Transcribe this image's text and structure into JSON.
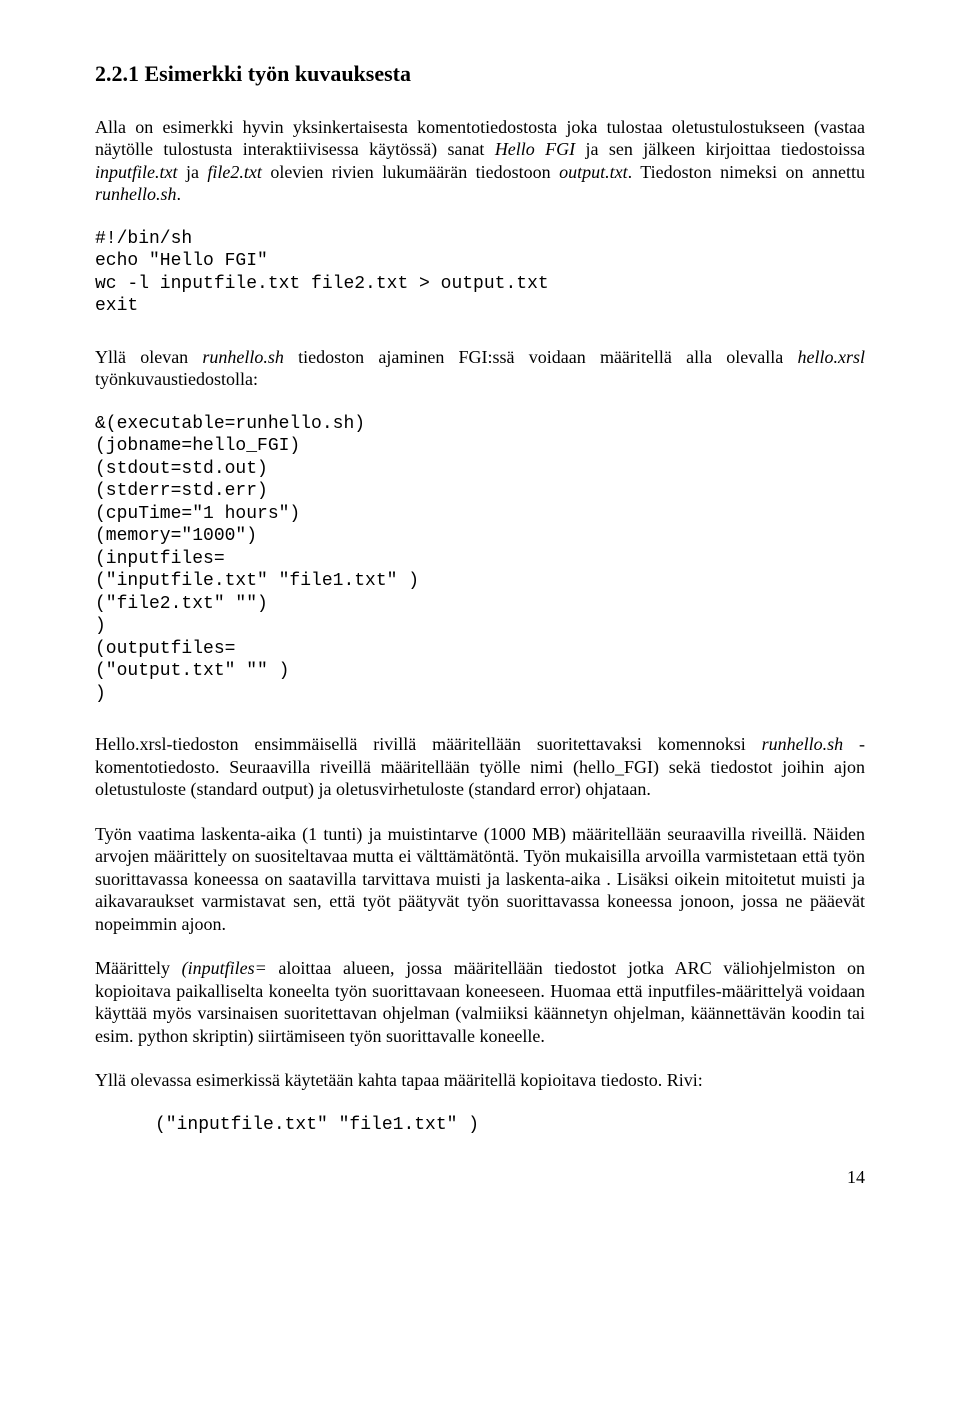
{
  "heading": "2.2.1 Esimerkki työn kuvauksesta",
  "p1a": "Alla on esimerkki hyvin yksinkertaisesta komentotiedostosta joka tulostaa oletustulostukseen (vastaa näytölle tulostusta interaktiivisessa käytössä) sanat ",
  "p1b": "Hello FGI",
  "p1c": " ja sen jälkeen kirjoittaa tiedostoissa ",
  "p1d": "inputfile.txt",
  "p1e": " ja ",
  "p1f": "file2.txt",
  "p1g": " olevien rivien lukumäärän tiedostoon ",
  "p1h": "output.txt",
  "p1i": ". Tiedoston nimeksi on annettu ",
  "p1j": "runhello.sh",
  "p1k": ".",
  "code1": "#!/bin/sh\necho \"Hello FGI\"\nwc -l inputfile.txt file2.txt > output.txt\nexit",
  "p2a": "Yllä olevan ",
  "p2b": "runhello.sh",
  "p2c": " tiedoston ajaminen FGI:ssä voidaan määritellä alla olevalla ",
  "p2d": "hello.xrsl",
  "p2e": " työnkuvaustiedostolla:",
  "code2": "&(executable=runhello.sh)\n(jobname=hello_FGI)\n(stdout=std.out)\n(stderr=std.err)\n(cpuTime=\"1 hours\")\n(memory=\"1000\")\n(inputfiles=\n(\"inputfile.txt\" \"file1.txt\" )\n(\"file2.txt\" \"\")\n)\n(outputfiles=\n(\"output.txt\" \"\" )\n)",
  "p3a": "Hello.xrsl-tiedoston ensimmäisellä rivillä määritellään suoritettavaksi komennoksi ",
  "p3b": "runhello.sh",
  "p3c": " -komentotiedosto. Seuraavilla riveillä määritellään työlle nimi (hello_FGI) sekä tiedostot joihin ajon oletustuloste (standard output)  ja oletusvirhetuloste (standard error) ohjataan.",
  "p4": "Työn vaatima laskenta-aika (1 tunti)  ja muistintarve (1000 MB) määritellään seuraavilla riveillä. Näiden arvojen määrittely on suositeltavaa mutta ei välttämätöntä. Työn mukaisilla arvoilla  varmistetaan että työn suorittavassa koneessa on saatavilla tarvittava muisti ja laskenta-aika . Lisäksi oikein mitoitetut muisti ja aikavaraukset varmistavat sen, että työt päätyvät työn suorittavassa koneessa jonoon, jossa ne pääevät nopeimmin ajoon.",
  "p5a": "Määrittely ",
  "p5b": "(inputfiles=",
  "p5c": " aloittaa alueen, jossa määritellään tiedostot jotka ARC väliohjelmiston on kopioitava paikalliselta koneelta työn suorittavaan koneeseen. Huomaa että inputfiles-määrittelyä voidaan käyttää  myös  varsinaisen suoritettavan ohjelman (valmiiksi käännetyn ohjelman, käännettävän koodin tai esim. python skriptin) siirtämiseen työn suorittavalle koneelle.",
  "p6": "Yllä olevassa esimerkissä käytetään kahta tapaa määritellä kopioitava tiedosto. Rivi:",
  "code3": "(\"inputfile.txt\" \"file1.txt\" )",
  "pagenum": "14"
}
